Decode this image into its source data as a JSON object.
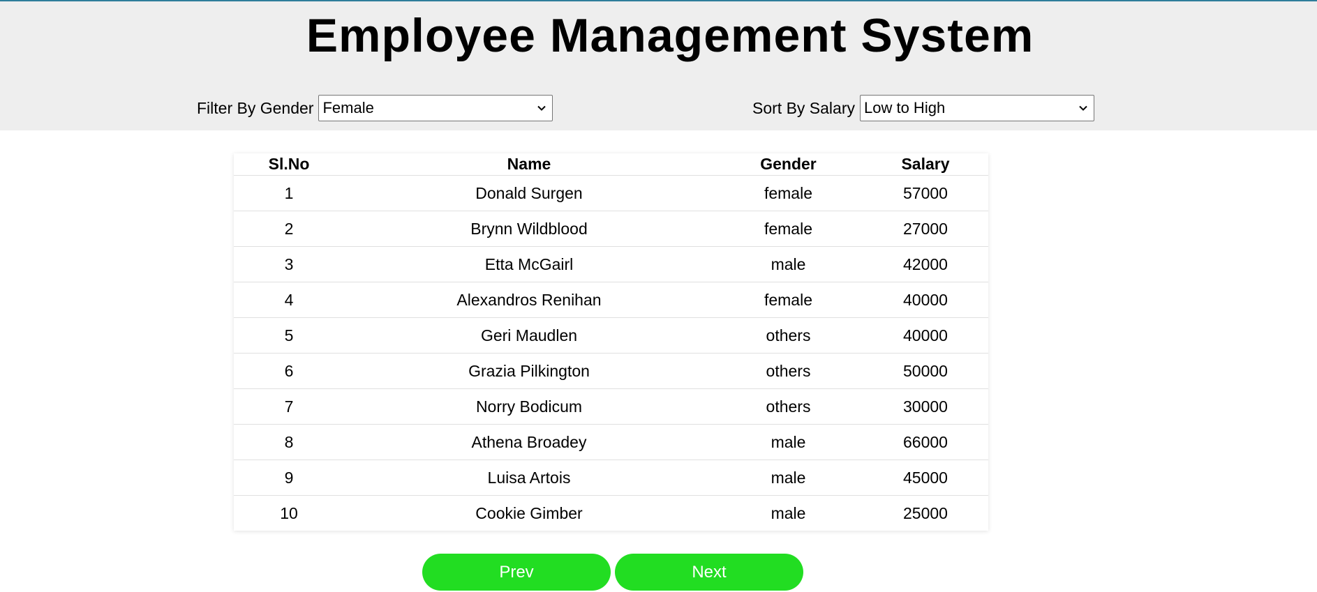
{
  "header": {
    "title": "Employee Management System"
  },
  "filters": {
    "gender_label": "Filter By Gender",
    "gender_value": "Female",
    "sort_label": "Sort By Salary",
    "sort_value": "Low to High"
  },
  "table": {
    "columns": [
      "Sl.No",
      "Name",
      "Gender",
      "Salary"
    ],
    "rows": [
      [
        "1",
        "Donald Surgen",
        "female",
        "57000"
      ],
      [
        "2",
        "Brynn Wildblood",
        "female",
        "27000"
      ],
      [
        "3",
        "Etta McGairl",
        "male",
        "42000"
      ],
      [
        "4",
        "Alexandros Renihan",
        "female",
        "40000"
      ],
      [
        "5",
        "Geri Maudlen",
        "others",
        "40000"
      ],
      [
        "6",
        "Grazia Pilkington",
        "others",
        "50000"
      ],
      [
        "7",
        "Norry Bodicum",
        "others",
        "30000"
      ],
      [
        "8",
        "Athena Broadey",
        "male",
        "66000"
      ],
      [
        "9",
        "Luisa Artois",
        "male",
        "45000"
      ],
      [
        "10",
        "Cookie Gimber",
        "male",
        "25000"
      ]
    ]
  },
  "pagination": {
    "prev_label": "Prev",
    "next_label": "Next"
  },
  "icons": {
    "dropdown": "chevron-down-icon"
  },
  "colors": {
    "header_bg": "#eeeeee",
    "button_bg": "#22dd22",
    "top_border": "#2e7d9a"
  }
}
